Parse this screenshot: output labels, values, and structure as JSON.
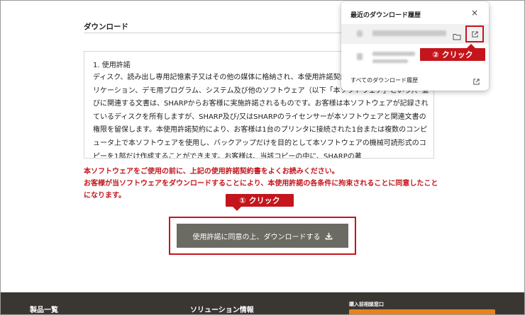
{
  "section": {
    "heading": "ダウンロード"
  },
  "license": {
    "title": "1. 使用許諾",
    "body": "ディスク、読み出し専用記憶素子又はその他の媒体に格納され、本使用許諾契約書が添付されているアプリケーション、デモ用プログラム、システム及び他のソフトウェア（以下「本ソフトウェア」という）、並びに関連する文書は、SHARPからお客様に実施許諾されるものです。お客様は本ソフトウェアが記録されているディスクを所有しますが、SHARP及び/又はSHARPのライセンサーが本ソフトウェアと関連文書の権限を留保します。本使用許諾契約により、お客様は1台のプリンタに接続された1台または複数のコンピュータ上で本ソフトウェアを使用し、バックアップだけを目的として本ソフトウェアの機械可読形式のコピーを1部だけ作成することができます。お客様は、当該コピーの中に、SHARPの著"
  },
  "warning": {
    "line1": "本ソフトウェアをご使用の前に、上記の使用許諾契約書をよくお読みください。",
    "line2": "お客様が当ソフトウェアをダウンロードすることにより、本使用許諾の各条件に拘束されることに同意したことになります。"
  },
  "callouts": {
    "step1": "① クリック",
    "step2": "② クリック"
  },
  "download_button": {
    "label": "使用許諾に同意の上、ダウンロードする"
  },
  "popup": {
    "title": "最近のダウンロード履歴",
    "close": "×",
    "all_history": "すべてのダウンロード履歴"
  },
  "footer": {
    "products": "製品一覧",
    "solutions": "ソリューション情報",
    "consult": "購入前相談窓口"
  },
  "colors": {
    "accent_red": "#c4151c",
    "button_gray": "#6b6b64",
    "footer_dark": "#3a3732",
    "footer_orange": "#e8821e"
  },
  "icons": {
    "close": "close-icon",
    "folder": "folder-icon",
    "open_external": "open-external-icon",
    "download": "download-icon"
  }
}
